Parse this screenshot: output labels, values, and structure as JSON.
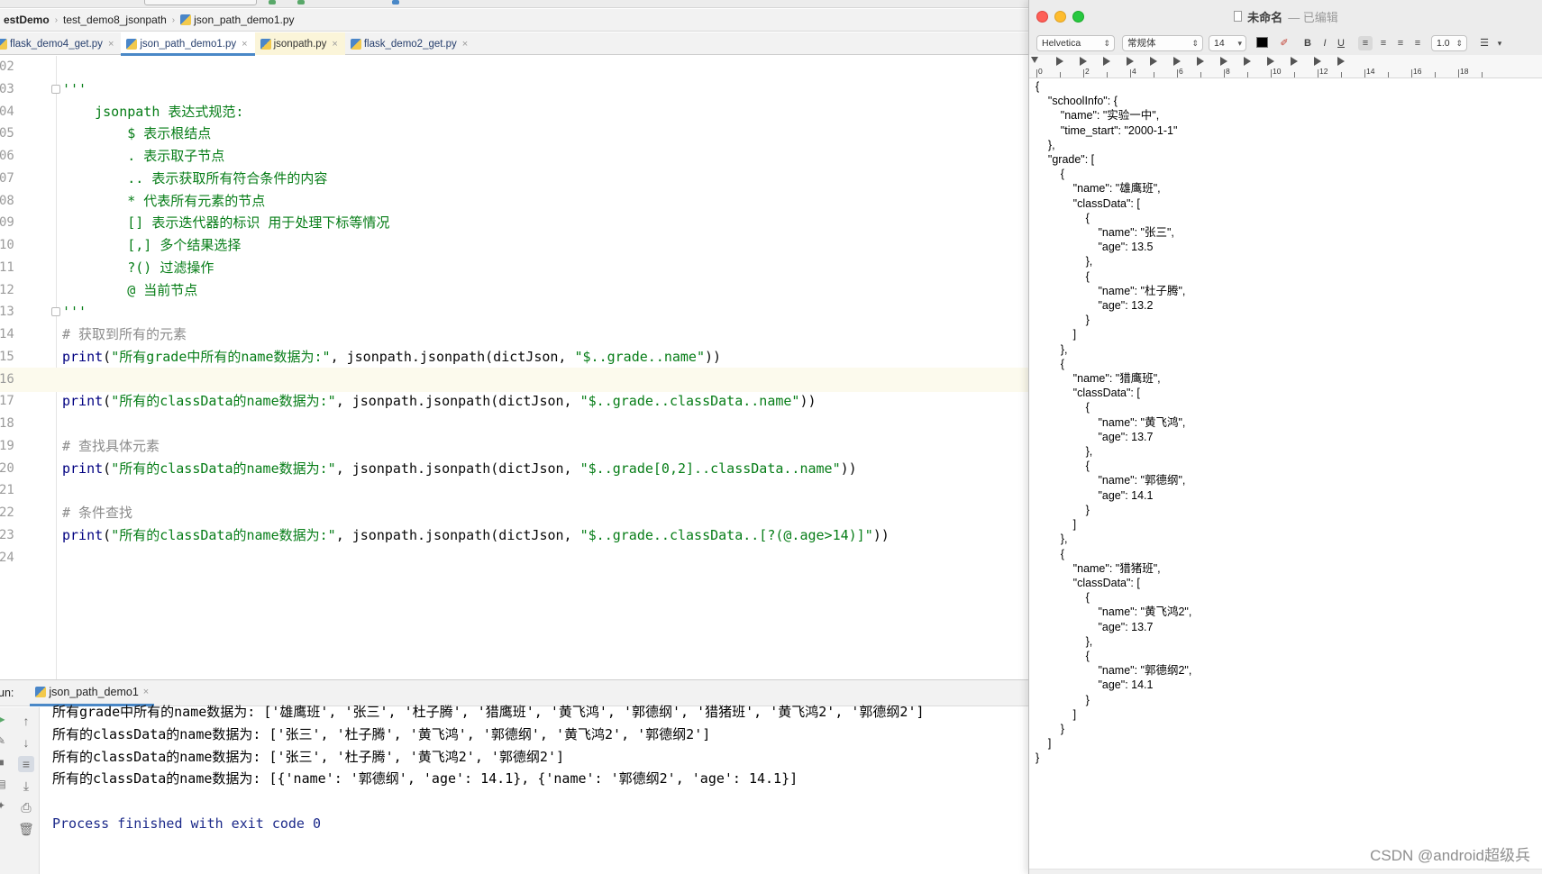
{
  "ide": {
    "breadcrumb": [
      "estDemo",
      "test_demo8_jsonpath",
      "json_path_demo1.py"
    ],
    "tabs": [
      {
        "label": "flask_demo4_get.py",
        "state": "normal"
      },
      {
        "label": "json_path_demo1.py",
        "state": "active"
      },
      {
        "label": "jsonpath.py",
        "state": "library"
      },
      {
        "label": "flask_demo2_get.py",
        "state": "normal"
      }
    ],
    "code_lines": [
      {
        "num": "02",
        "text": ""
      },
      {
        "num": "03",
        "text": "'''"
      },
      {
        "num": "04",
        "text": "    jsonpath 表达式规范:"
      },
      {
        "num": "05",
        "text": "        $ 表示根结点"
      },
      {
        "num": "06",
        "text": "        . 表示取子节点"
      },
      {
        "num": "07",
        "text": "        .. 表示获取所有符合条件的内容"
      },
      {
        "num": "08",
        "text": "        * 代表所有元素的节点"
      },
      {
        "num": "09",
        "text": "        [] 表示迭代器的标识 用于处理下标等情况"
      },
      {
        "num": "10",
        "text": "        [,] 多个结果选择"
      },
      {
        "num": "11",
        "text": "        ?() 过滤操作"
      },
      {
        "num": "12",
        "text": "        @ 当前节点"
      },
      {
        "num": "13",
        "text": "'''"
      },
      {
        "num": "14",
        "text": "# 获取到所有的元素"
      },
      {
        "num": "15",
        "text": "print(\"所有grade中所有的name数据为:\", jsonpath.jsonpath(dictJson, \"$..grade..name\"))"
      },
      {
        "num": "16",
        "text": ""
      },
      {
        "num": "17",
        "text": "print(\"所有的classData的name数据为:\", jsonpath.jsonpath(dictJson, \"$..grade..classData..name\"))"
      },
      {
        "num": "18",
        "text": ""
      },
      {
        "num": "19",
        "text": "# 查找具体元素"
      },
      {
        "num": "20",
        "text": "print(\"所有的classData的name数据为:\", jsonpath.jsonpath(dictJson, \"$..grade[0,2]..classData..name\"))"
      },
      {
        "num": "21",
        "text": ""
      },
      {
        "num": "22",
        "text": "# 条件查找"
      },
      {
        "num": "23",
        "text": "print(\"所有的classData的name数据为:\", jsonpath.jsonpath(dictJson, \"$..grade..classData..[?(@.age>14)]\"))"
      },
      {
        "num": "24",
        "text": ""
      }
    ],
    "run": {
      "label": "un:",
      "tab": "json_path_demo1",
      "output": [
        "所有grade中所有的name数据为: ['雄鹰班', '张三', '杜子腾', '猎鹰班', '黄飞鸿', '郭德纲', '猎猪班', '黄飞鸿2', '郭德纲2']",
        "所有的classData的name数据为: ['张三', '杜子腾', '黄飞鸿', '郭德纲', '黄飞鸿2', '郭德纲2']",
        "所有的classData的name数据为: ['张三', '杜子腾', '黄飞鸿2', '郭德纲2']",
        "所有的classData的name数据为: [{'name': '郭德纲', 'age': 14.1}, {'name': '郭德纲2', 'age': 14.1}]",
        "",
        "Process finished with exit code 0"
      ]
    }
  },
  "textedit": {
    "doc_name": "未命名",
    "doc_state": "— 已编辑",
    "font_family": "Helvetica",
    "font_style": "常规体",
    "font_size": "14",
    "line_spacing": "1.0",
    "ruler_numbers": [
      "0",
      "2",
      "4",
      "6",
      "8",
      "10",
      "12",
      "14",
      "16",
      "18"
    ],
    "content": "{\n    \"schoolInfo\": {\n        \"name\": \"实验一中\",\n        \"time_start\": \"2000-1-1\"\n    },\n    \"grade\": [\n        {\n            \"name\": \"雄鹰班\",\n            \"classData\": [\n                {\n                    \"name\": \"张三\",\n                    \"age\": 13.5\n                },\n                {\n                    \"name\": \"杜子腾\",\n                    \"age\": 13.2\n                }\n            ]\n        },\n        {\n            \"name\": \"猎鹰班\",\n            \"classData\": [\n                {\n                    \"name\": \"黄飞鸿\",\n                    \"age\": 13.7\n                },\n                {\n                    \"name\": \"郭德纲\",\n                    \"age\": 14.1\n                }\n            ]\n        },\n        {\n            \"name\": \"猎猪班\",\n            \"classData\": [\n                {\n                    \"name\": \"黄飞鸿2\",\n                    \"age\": 13.7\n                },\n                {\n                    \"name\": \"郭德纲2\",\n                    \"age\": 14.1\n                }\n            ]\n        }\n    ]\n}",
    "watermark": "CSDN @android超级兵"
  }
}
